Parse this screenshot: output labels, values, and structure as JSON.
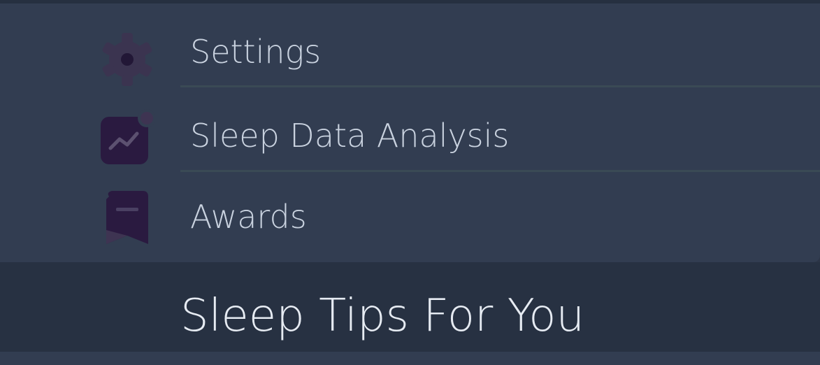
{
  "menu": {
    "items": [
      {
        "label": "Settings",
        "icon": "gear-icon"
      },
      {
        "label": "Sleep Data Analysis",
        "icon": "chart-notification-icon"
      },
      {
        "label": "Awards",
        "icon": "bookmark-award-icon"
      }
    ]
  },
  "section": {
    "title": "Sleep Tips For You"
  },
  "colors": {
    "background": "#2c3547",
    "card": "#323d51",
    "header": "#273142",
    "text": "#c9d2df",
    "icon_dark": "#2a1b3d",
    "icon_muted": "#3e3452"
  }
}
